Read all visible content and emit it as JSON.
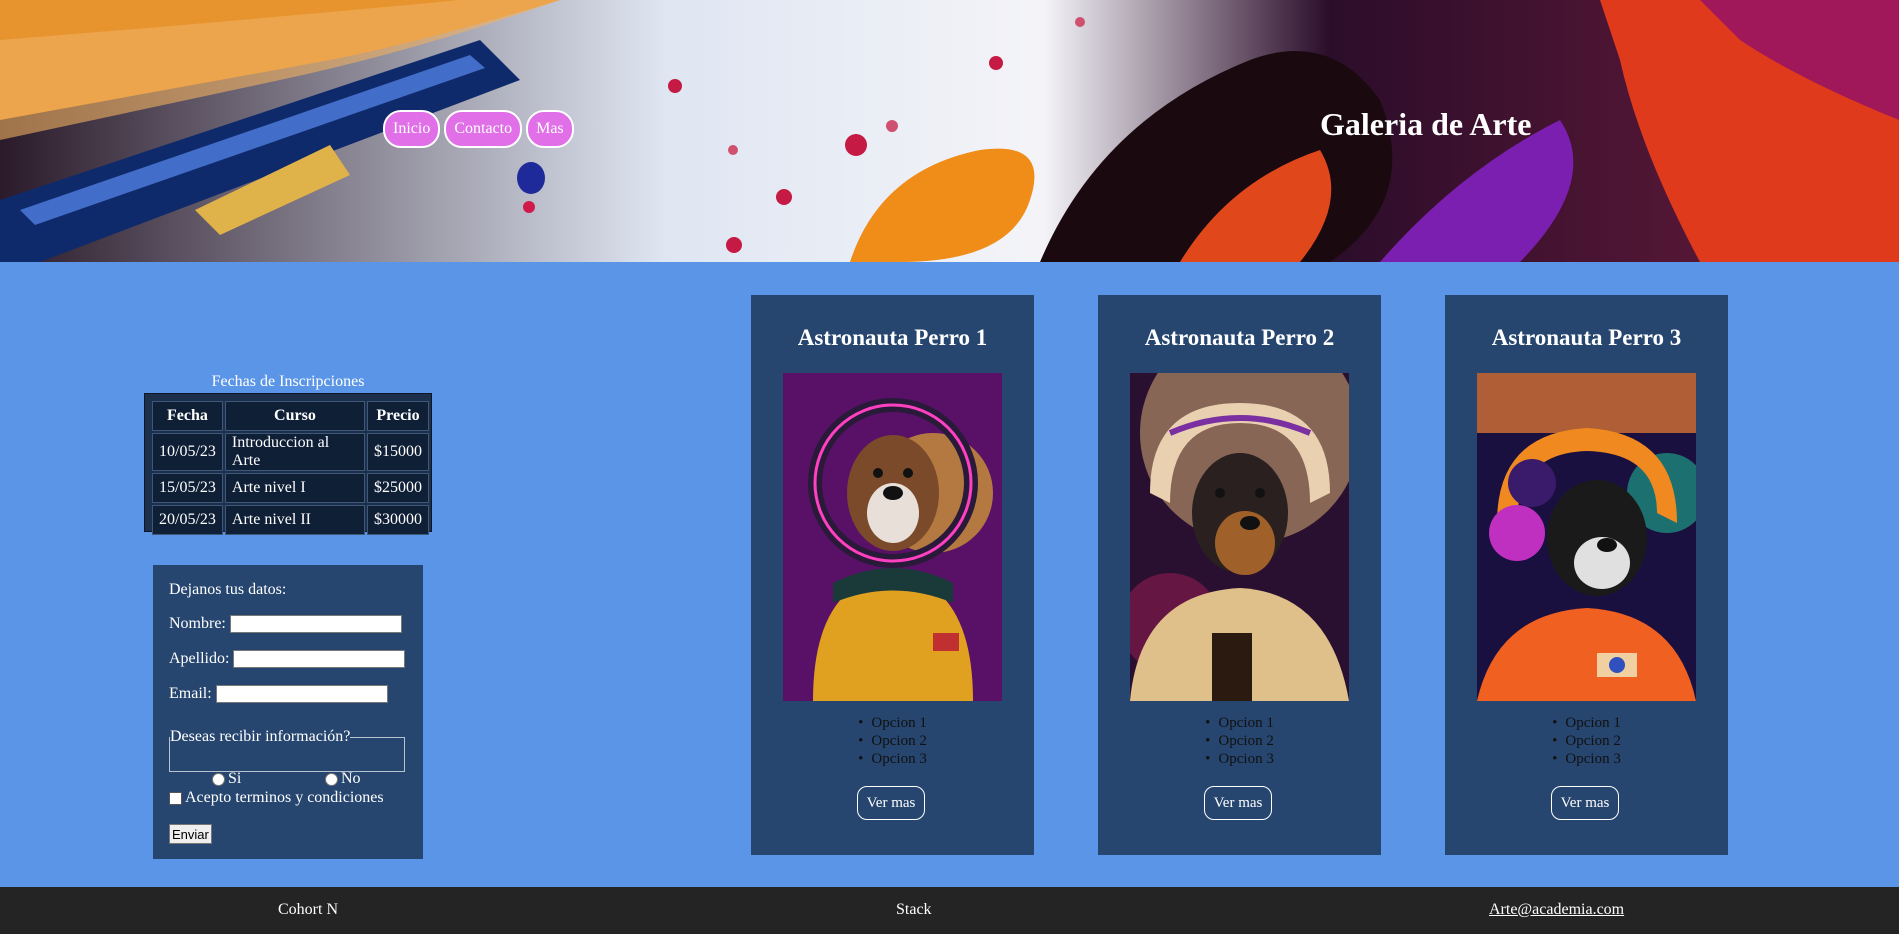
{
  "header": {
    "title": "Galeria de Arte",
    "nav": [
      "Inicio",
      "Contacto",
      "Mas"
    ]
  },
  "schedule": {
    "caption": "Fechas de Inscripciones",
    "headers": [
      "Fecha",
      "Curso",
      "Precio"
    ],
    "rows": [
      [
        "10/05/23",
        "Introduccion al Arte",
        "$15000"
      ],
      [
        "15/05/23",
        "Arte nivel I",
        "$25000"
      ],
      [
        "20/05/23",
        "Arte nivel II",
        "$30000"
      ]
    ]
  },
  "form": {
    "intro": "Dejanos tus datos:",
    "nombre_label": "Nombre:",
    "apellido_label": "Apellido:",
    "email_label": "Email:",
    "legend": "Deseas recibir información?",
    "radio_si": "Si",
    "radio_no": "No",
    "terms": "Acepto terminos y condiciones",
    "submit": "Enviar"
  },
  "cards": [
    {
      "title": "Astronauta Perro 1",
      "options": [
        "Opcion 1",
        "Opcion 2",
        "Opcion 3"
      ],
      "button": "Ver mas"
    },
    {
      "title": "Astronauta Perro 2",
      "options": [
        "Opcion 1",
        "Opcion 2",
        "Opcion 3"
      ],
      "button": "Ver mas"
    },
    {
      "title": "Astronauta Perro 3",
      "options": [
        "Opcion 1",
        "Opcion 2",
        "Opcion 3"
      ],
      "button": "Ver mas"
    }
  ],
  "footer": {
    "left": "Cohort N",
    "center": "Stack",
    "email": "Arte@academia.com"
  },
  "colors": {
    "page_bg": "#5b95e8",
    "panel_bg": "#26466f",
    "nav_pink": "#e06fe8",
    "footer_bg": "#242424"
  }
}
